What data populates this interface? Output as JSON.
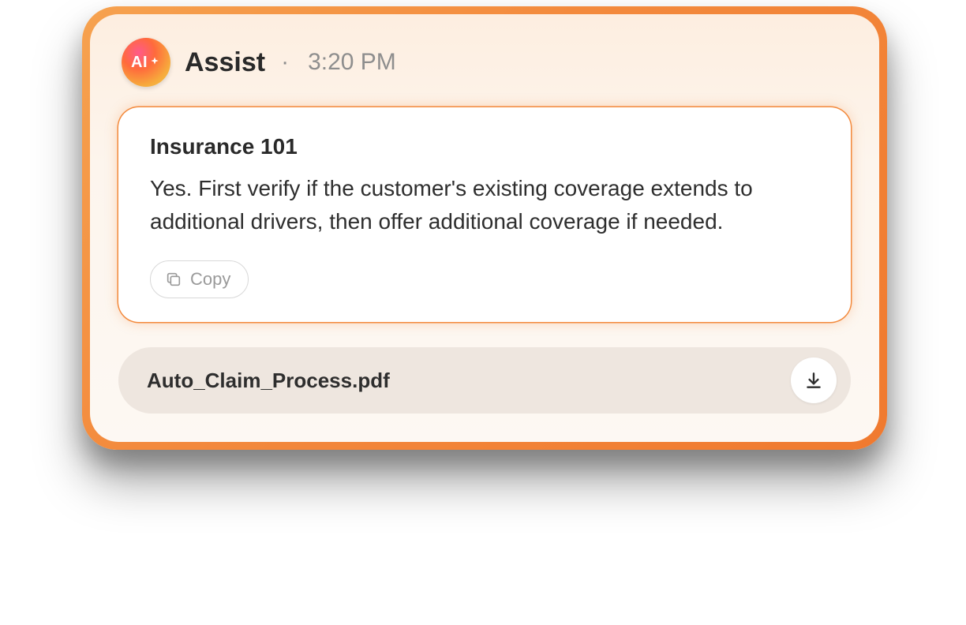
{
  "header": {
    "avatar_label": "AI",
    "name": "Assist",
    "separator": "·",
    "timestamp": "3:20 PM"
  },
  "answer": {
    "title": "Insurance 101",
    "body": "Yes. First verify if the customer's existing coverage extends to additional drivers, then offer additional coverage if needed.",
    "copy_label": "Copy"
  },
  "attachment": {
    "filename": "Auto_Claim_Process.pdf"
  }
}
